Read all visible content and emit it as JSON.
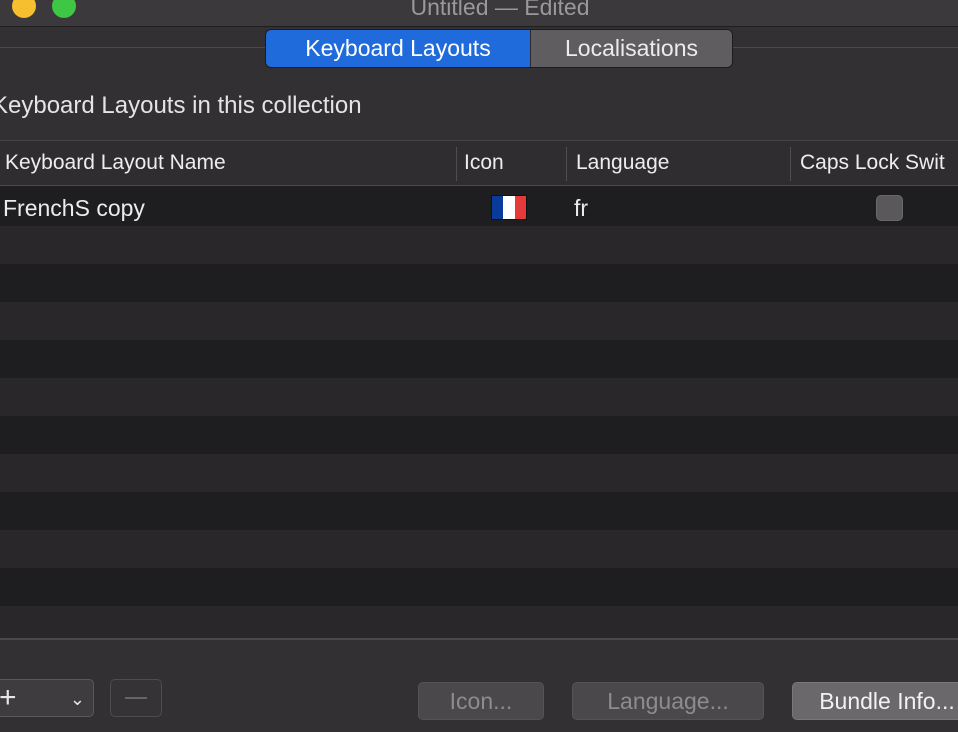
{
  "window": {
    "title": "Untitled — Edited"
  },
  "tabs": [
    {
      "label": "Keyboard Layouts",
      "selected": true
    },
    {
      "label": "Localisations",
      "selected": false
    }
  ],
  "section": {
    "title": "Keyboard Layouts in this collection"
  },
  "table": {
    "columns": [
      "Keyboard Layout Name",
      "Icon",
      "Language",
      "Caps Lock Swit"
    ],
    "rows": [
      {
        "name": "FrenchS copy",
        "icon": "french-flag-icon",
        "language": "fr",
        "caps_lock_switch": false
      }
    ]
  },
  "footer": {
    "add_icon": "+",
    "chevron_icon": "⌄",
    "icon_button": "Icon...",
    "language_button": "Language...",
    "bundle_button": "Bundle Info..."
  },
  "colors": {
    "accent": "#1f6bdc",
    "flag_blue": "#0a3b9a",
    "flag_white": "#ffffff",
    "flag_red": "#e63a3a",
    "traffic_yellow": "#f5bf2f",
    "traffic_green": "#3ec744"
  }
}
